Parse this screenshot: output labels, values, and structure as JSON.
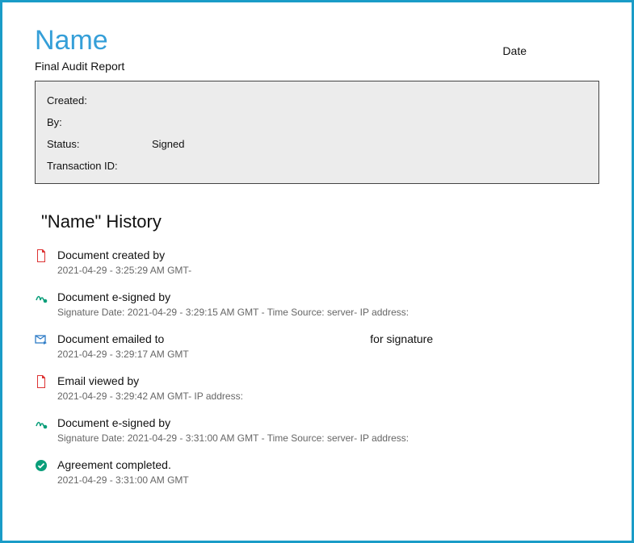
{
  "header": {
    "name_label": "Name",
    "date_label": "Date",
    "subtitle": "Final Audit Report"
  },
  "info": {
    "created_label": "Created:",
    "created_value": "",
    "by_label": "By:",
    "by_value": "",
    "status_label": "Status:",
    "status_value": "Signed",
    "txn_label": "Transaction ID:",
    "txn_value": ""
  },
  "history_title": "\"Name\" History",
  "history": [
    {
      "icon": "document-icon",
      "main": "Document created by",
      "sub": "2021-04-29 - 3:25:29 AM GMT-"
    },
    {
      "icon": "signature-icon",
      "main": "Document e-signed by",
      "sub": "Signature Date: 2021-04-29 - 3:29:15 AM GMT - Time Source: server- IP address:"
    },
    {
      "icon": "email-icon",
      "main_prefix": "Document emailed to",
      "main_suffix": "for signature",
      "sub": "2021-04-29 - 3:29:17 AM GMT"
    },
    {
      "icon": "document-icon",
      "main": "Email viewed by",
      "sub": "2021-04-29 - 3:29:42 AM GMT- IP address:"
    },
    {
      "icon": "signature-icon",
      "main": "Document e-signed by",
      "sub": "Signature Date: 2021-04-29 - 3:31:00 AM GMT - Time Source: server- IP address:"
    },
    {
      "icon": "check-icon",
      "main": "Agreement completed.",
      "sub": "2021-04-29 - 3:31:00 AM GMT"
    }
  ]
}
